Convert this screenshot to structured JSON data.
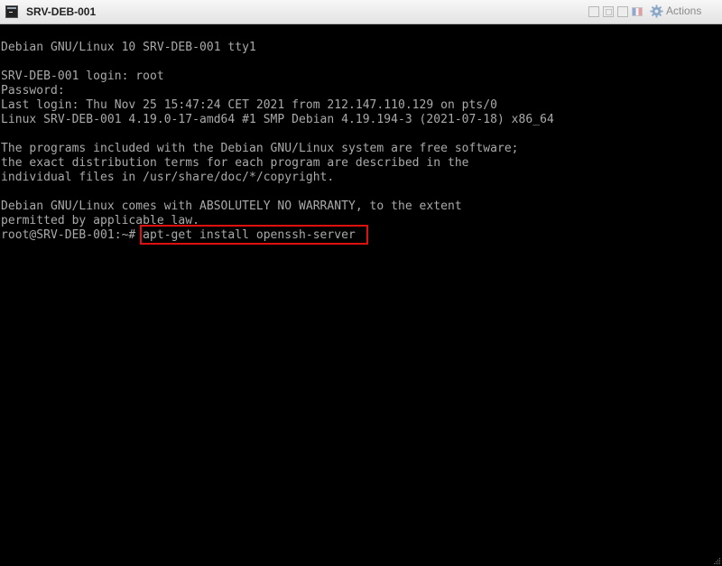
{
  "window": {
    "title": "SRV-DEB-001",
    "actions_label": "Actions",
    "icons": [
      "console-icon",
      "send-ctrl-alt-del-icon",
      "fullscreen-icon",
      "window-icon",
      "keyboard-layout-flag-icon",
      "gear-icon"
    ]
  },
  "console": {
    "lines": [
      "Debian GNU/Linux 10 SRV-DEB-001 tty1",
      "",
      "SRV-DEB-001 login: root",
      "Password:",
      "Last login: Thu Nov 25 15:47:24 CET 2021 from 212.147.110.129 on pts/0",
      "Linux SRV-DEB-001 4.19.0-17-amd64 #1 SMP Debian 4.19.194-3 (2021-07-18) x86_64",
      "",
      "The programs included with the Debian GNU/Linux system are free software;",
      "the exact distribution terms for each program are described in the",
      "individual files in /usr/share/doc/*/copyright.",
      "",
      "Debian GNU/Linux comes with ABSOLUTELY NO WARRANTY, to the extent",
      "permitted by applicable law.",
      "root@SRV-DEB-001:~# apt-get install openssh-server"
    ],
    "highlighted_command": "apt-get install openssh-server",
    "highlight_color": "#e01010",
    "text_color": "#aaaaaa",
    "background_color": "#000000"
  }
}
